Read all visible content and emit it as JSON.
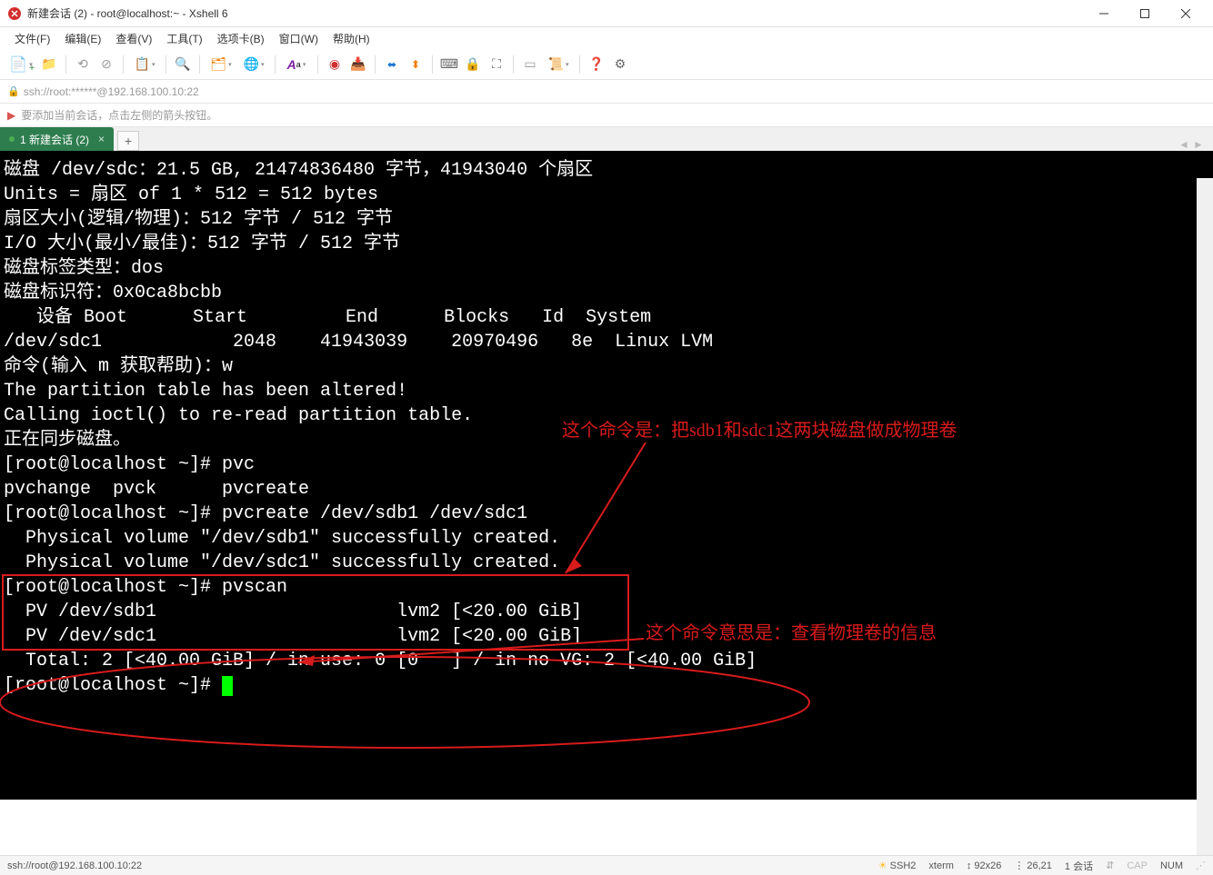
{
  "window": {
    "title": "新建会话 (2) - root@localhost:~ - Xshell 6"
  },
  "menu": {
    "file": "文件(F)",
    "edit": "编辑(E)",
    "view": "查看(V)",
    "tools": "工具(T)",
    "tabs": "选项卡(B)",
    "window": "窗口(W)",
    "help": "帮助(H)"
  },
  "address": "ssh://root:******@192.168.100.10:22",
  "hint": "要添加当前会话，点击左侧的箭头按钮。",
  "tab": {
    "label": "1 新建会话 (2)",
    "close": "×",
    "plus": "+"
  },
  "terminal": {
    "lines": [
      "磁盘 /dev/sdc：21.5 GB, 21474836480 字节，41943040 个扇区",
      "Units = 扇区 of 1 * 512 = 512 bytes",
      "扇区大小(逻辑/物理)：512 字节 / 512 字节",
      "I/O 大小(最小/最佳)：512 字节 / 512 字节",
      "磁盘标签类型：dos",
      "磁盘标识符：0x0ca8bcbb",
      "",
      "   设备 Boot      Start         End      Blocks   Id  System",
      "/dev/sdc1            2048    41943039    20970496   8e  Linux LVM",
      "",
      "命令(输入 m 获取帮助)：w",
      "The partition table has been altered!",
      "",
      "Calling ioctl() to re-read partition table.",
      "正在同步磁盘。",
      "[root@localhost ~]# pvc",
      "pvchange  pvck      pvcreate  ",
      "[root@localhost ~]# pvcreate /dev/sdb1 /dev/sdc1",
      "  Physical volume \"/dev/sdb1\" successfully created.",
      "  Physical volume \"/dev/sdc1\" successfully created.",
      "[root@localhost ~]# pvscan",
      "  PV /dev/sdb1                      lvm2 [<20.00 GiB]",
      "  PV /dev/sdc1                      lvm2 [<20.00 GiB]",
      "  Total: 2 [<40.00 GiB] / in use: 0 [0   ] / in no VG: 2 [<40.00 GiB]",
      "[root@localhost ~]# "
    ]
  },
  "annotations": {
    "text1": "这个命令是：把sdb1和sdc1这两块磁盘做成物理卷",
    "text2": "这个命令意思是：查看物理卷的信息"
  },
  "status": {
    "left": "ssh://root@192.168.100.10:22",
    "proto": "SSH2",
    "term": "xterm",
    "size": "92x26",
    "pos": "26,21",
    "sessions": "1 会话",
    "cap": "CAP",
    "num": "NUM"
  }
}
